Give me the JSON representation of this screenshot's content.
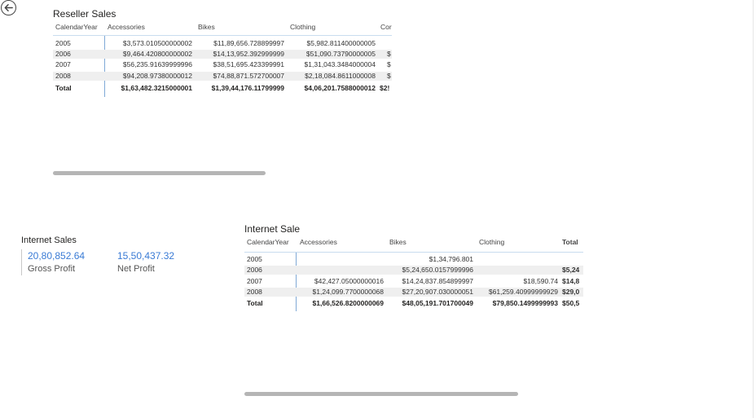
{
  "nav": {
    "back_icon": "back-arrow-icon"
  },
  "reseller": {
    "title": "Reseller Sales",
    "columns": [
      "CalendarYear",
      "Accessories",
      "Bikes",
      "Clothing",
      "Cor"
    ],
    "rows": [
      [
        "2005",
        "$3,573.010500000002",
        "$11,89,656.728899997",
        "$5,982.811400000005",
        ""
      ],
      [
        "2006",
        "$9,464.420800000002",
        "$14,13,952.392999999",
        "$51,090.73790000005",
        "$"
      ],
      [
        "2007",
        "$56,235.91639999996",
        "$38,51,695.423399991",
        "$1,31,043.3484000004",
        "$"
      ],
      [
        "2008",
        "$94,208.97380000012",
        "$74,88,871.572700007",
        "$2,18,084.8611000008",
        "$"
      ]
    ],
    "total": [
      "Total",
      "$1,63,482.3215000001",
      "$1,39,44,176.11799999",
      "$4,06,201.7588000012",
      "$2!"
    ]
  },
  "internet_card": {
    "title": "Internet Sales",
    "gross_profit_value": "20,80,852.64",
    "gross_profit_label": "Gross Profit",
    "net_profit_value": "15,50,437.32",
    "net_profit_label": "Net Profit"
  },
  "internet": {
    "title": "Internet Sale",
    "columns": [
      "CalendarYear",
      "Accessories",
      "Bikes",
      "Clothing",
      "Total"
    ],
    "rows": [
      [
        "2005",
        "",
        "$1,34,796.801",
        "",
        ""
      ],
      [
        "2006",
        "",
        "$5,24,650.0157999996",
        "",
        "$5,24"
      ],
      [
        "2007",
        "$42,427.05000000016",
        "$14,24,837.854899997",
        "$18,590.74",
        "$14,8"
      ],
      [
        "2008",
        "$1,24,099.7700000068",
        "$27,20,907.030000051",
        "$61,259.40999999929",
        "$29,0"
      ]
    ],
    "total": [
      "Total",
      "$1,66,526.8200000069",
      "$48,05,191.701700049",
      "$79,850.1499999993",
      "$50,5"
    ]
  }
}
